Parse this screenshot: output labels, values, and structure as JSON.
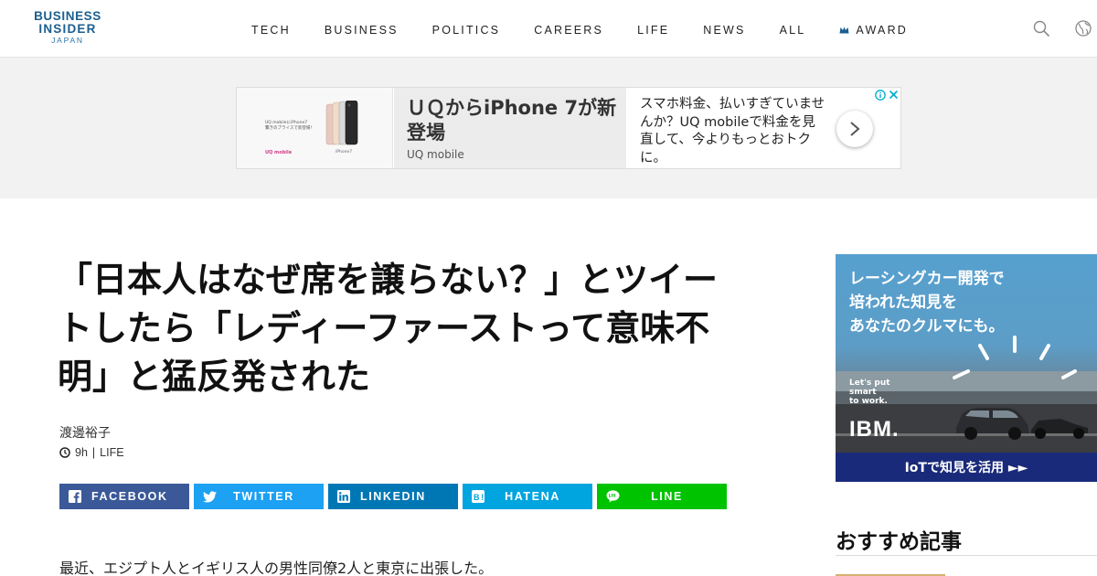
{
  "logo": {
    "line1": "BUSINESS",
    "line2": "INSIDER",
    "line3": "JAPAN",
    "color": "#1b5f8f"
  },
  "nav": {
    "items": [
      {
        "label": "TECH"
      },
      {
        "label": "BUSINESS"
      },
      {
        "label": "POLITICS"
      },
      {
        "label": "CAREERS"
      },
      {
        "label": "LIFE"
      },
      {
        "label": "NEWS"
      },
      {
        "label": "ALL"
      },
      {
        "label": "AWARD"
      }
    ],
    "icons": [
      "search-icon",
      "globe-icon"
    ]
  },
  "ad_banner": {
    "image_text": "UQ mobileにiPhone7\n驚きのプライスで新登場!",
    "image_logo": "UQ mobile",
    "image_model": "iPhone7",
    "title": "ＵＱからiPhone 7が新登場",
    "source": "UQ mobile",
    "description": "スマホ料金、払いすぎていませんか？UQ mobileで料金を見直して、今よりもっとおトクに。"
  },
  "article": {
    "title": "「日本人はなぜ席を譲らない？」とツイートしたら「レディーファーストって意味不明」と猛反発された",
    "author": "渡邊裕子",
    "time": "9h",
    "separator": "|",
    "category": "LIFE",
    "first_paragraph": "最近、エジプト人とイギリス人の男性同僚2人と東京に出張した。"
  },
  "share": {
    "facebook": "FACEBOOK",
    "twitter": "TWITTER",
    "linkedin": "LINKEDIN",
    "hatena": "HATENA",
    "line": "LINE",
    "colors": {
      "facebook": "#3b5998",
      "twitter": "#1da1f2",
      "linkedin": "#0077b5",
      "hatena": "#00a4de",
      "line": "#00c300"
    }
  },
  "sidebar": {
    "ad": {
      "copy_line1": "レーシングカー開発で",
      "copy_line2": "培われた知見を",
      "copy_line3": "あなたのクルマにも。",
      "tagline1": "Let's put",
      "tagline2": "smart",
      "tagline3": "to work.",
      "brand": "IBM.",
      "footer": "IoTで知見を活用 ►►"
    },
    "recommended_title": "おすすめ記事"
  }
}
